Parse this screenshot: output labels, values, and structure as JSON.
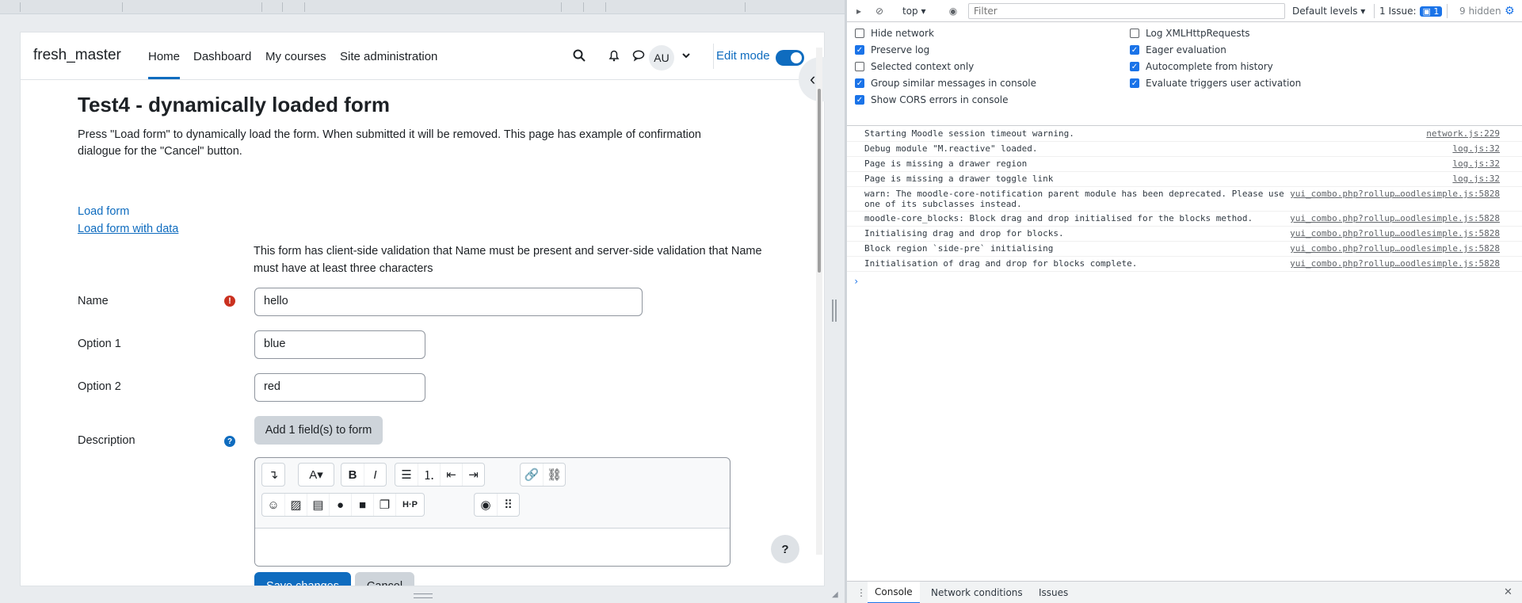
{
  "page": {
    "site_name": "fresh_master",
    "nav": [
      "Home",
      "Dashboard",
      "My courses",
      "Site administration"
    ],
    "user_initials": "AU",
    "edit_mode_label": "Edit mode",
    "title": "Test4 - dynamically loaded form",
    "intro": "Press \"Load form\" to dynamically load the form. When submitted it will be removed. This page has example of confirmation dialogue for the \"Cancel\" button.",
    "links": [
      "Load form",
      "Load form with data"
    ],
    "note": "This form has client-side validation that Name must be present and server-side validation that Name must have at least three characters",
    "fields": {
      "name_label": "Name",
      "name_value": "hello",
      "option1_label": "Option 1",
      "option1_value": "blue",
      "option2_label": "Option 2",
      "option2_value": "red",
      "description_label": "Description"
    },
    "add_field_button": "Add 1 field(s) to form",
    "save_button": "Save changes",
    "cancel_button": "Cancel",
    "help_button": "?"
  },
  "devtools": {
    "context": "top",
    "filter_placeholder": "Filter",
    "levels": "Default levels",
    "issues_label": "1 Issue:",
    "issues_count": "1",
    "hidden": "9 hidden",
    "settings": [
      {
        "label": "Hide network",
        "checked": false
      },
      {
        "label": "Log XMLHttpRequests",
        "checked": false
      },
      {
        "label": "Preserve log",
        "checked": true
      },
      {
        "label": "Eager evaluation",
        "checked": true
      },
      {
        "label": "Selected context only",
        "checked": false
      },
      {
        "label": "Autocomplete from history",
        "checked": true
      },
      {
        "label": "Group similar messages in console",
        "checked": true
      },
      {
        "label": "Evaluate triggers user activation",
        "checked": true
      },
      {
        "label": "Show CORS errors in console",
        "checked": true
      }
    ],
    "messages": [
      {
        "text": "Starting Moodle session timeout warning.",
        "source": "network.js:229"
      },
      {
        "text": "Debug module \"M.reactive\" loaded.",
        "source": "log.js:32"
      },
      {
        "text": "Page is missing a drawer region",
        "source": "log.js:32"
      },
      {
        "text": "Page is missing a drawer toggle link",
        "source": "log.js:32"
      },
      {
        "text": "warn: The moodle-core-notification parent module has been deprecated. Please use one of its subclasses instead.",
        "source": "yui_combo.php?rollup…oodlesimple.js:5828"
      },
      {
        "text": "moodle-core_blocks: Block drag and drop initialised for the blocks method.",
        "source": "yui_combo.php?rollup…oodlesimple.js:5828"
      },
      {
        "text": "Initialising drag and drop for blocks.",
        "source": "yui_combo.php?rollup…oodlesimple.js:5828"
      },
      {
        "text": "Block region `side-pre` initialising",
        "source": "yui_combo.php?rollup…oodlesimple.js:5828"
      },
      {
        "text": "Initialisation of drag and drop for blocks complete.",
        "source": "yui_combo.php?rollup…oodlesimple.js:5828"
      }
    ],
    "tabs": [
      "Console",
      "Network conditions",
      "Issues"
    ]
  }
}
